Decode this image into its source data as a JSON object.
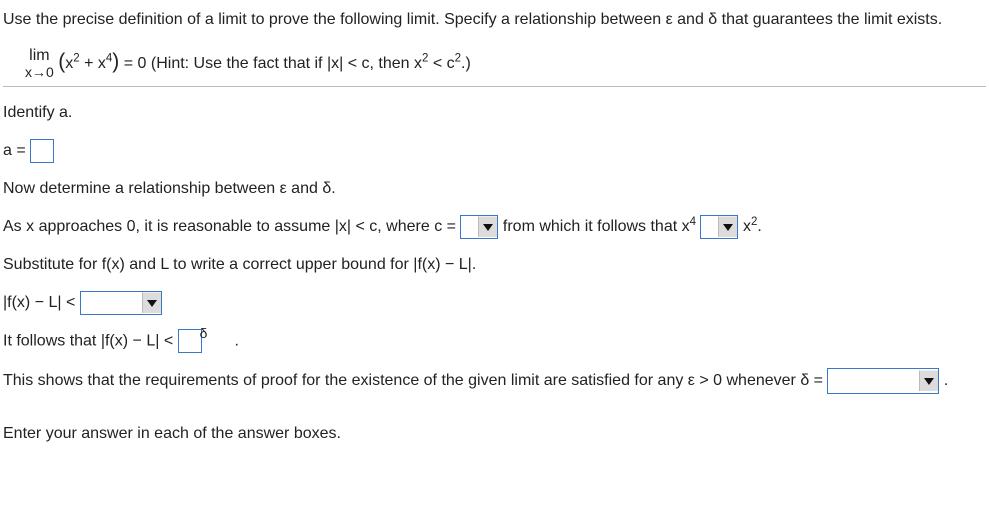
{
  "intro": {
    "prompt": "Use the precise definition of a limit to prove the following limit. Specify a relationship between ε and δ that guarantees the limit exists.",
    "lim_word": "lim",
    "lim_approach": "x→0",
    "expr_open": "(",
    "expr_term1": "x",
    "expr_exp1": "2",
    "expr_plus": " + ",
    "expr_term2": "x",
    "expr_exp2": "4",
    "expr_close": ")",
    "equals_zero": " = 0 ",
    "hint": "(Hint: Use the fact that if |x| < c, then x",
    "hint_exp1": "2",
    "hint_mid": " < c",
    "hint_exp2": "2",
    "hint_end": ".)"
  },
  "q1": {
    "identify": "Identify a.",
    "a_equals": "a = "
  },
  "q2": {
    "now": "Now determine a relationship between ε and δ.",
    "as_x_1": "As x approaches 0, it is reasonable to assume |x| < c, where c = ",
    "follows_pre": " from which it follows that x",
    "exp4": "4",
    "mid_space": " ",
    "x_label": "x",
    "exp2": "2",
    "period": "."
  },
  "q3": {
    "sub": "Substitute for f(x) and L to write a correct upper bound for |f(x) − L|.",
    "lhs": "|f(x) − L| < "
  },
  "q4": {
    "follows": "It follows that |f(x) − L| < ",
    "delta_frag": "δ"
  },
  "q5": {
    "shows": "This shows that the requirements of proof for the existence of the given limit are satisfied for any ε > 0 whenever δ = "
  },
  "footer": {
    "enter": "Enter your answer in each of the answer boxes."
  }
}
